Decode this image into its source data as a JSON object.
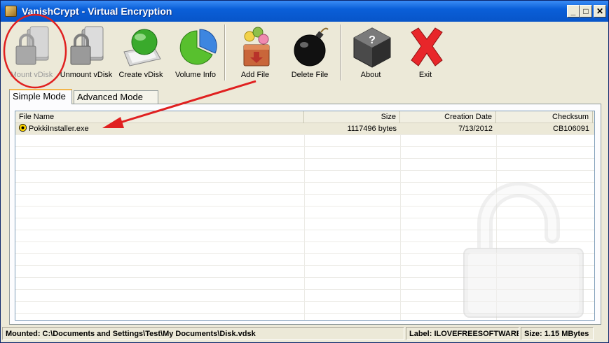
{
  "window": {
    "title": "VanishCrypt - Virtual Encryption",
    "controls": {
      "minimize": "_",
      "maximize": "□",
      "close": "✕"
    }
  },
  "toolbar": {
    "buttons": [
      {
        "label": "Mount vDisk",
        "icon": "lock-folder-icon",
        "enabled": false
      },
      {
        "label": "Unmount vDisk",
        "icon": "lock-folder-icon",
        "enabled": true
      },
      {
        "label": "Create vDisk",
        "icon": "globe-monitor-icon",
        "enabled": true
      },
      {
        "label": "Volume Info",
        "icon": "pie-chart-icon",
        "enabled": true
      },
      {
        "label": "Add File",
        "icon": "box-arrow-icon",
        "enabled": true
      },
      {
        "label": "Delete File",
        "icon": "bomb-icon",
        "enabled": true
      },
      {
        "label": "About",
        "icon": "question-cube-icon",
        "enabled": true
      },
      {
        "label": "Exit",
        "icon": "red-x-icon",
        "enabled": true
      }
    ]
  },
  "tabs": [
    {
      "label": "Simple Mode",
      "active": true
    },
    {
      "label": "Advanced Mode",
      "active": false
    }
  ],
  "file_list": {
    "columns": [
      "File Name",
      "Size",
      "Creation Date",
      "Checksum"
    ],
    "rows": [
      {
        "name": "PokkiInstaller.exe",
        "icon": "radioactive-icon",
        "size": "1117496 bytes",
        "date": "7/13/2012",
        "checksum": "CB106091"
      }
    ]
  },
  "statusbar": {
    "mounted": "Mounted: C:\\Documents and Settings\\Test\\My Documents\\Disk.vdsk",
    "label": "Label: ILOVEFREESOFTWARE",
    "size": "Size: 1.15 MBytes"
  },
  "colors": {
    "titlebar": "#0a5fd8",
    "window_bg": "#ece9d8",
    "annotation_red": "#e02020",
    "tab_highlight": "#f3b54a"
  }
}
